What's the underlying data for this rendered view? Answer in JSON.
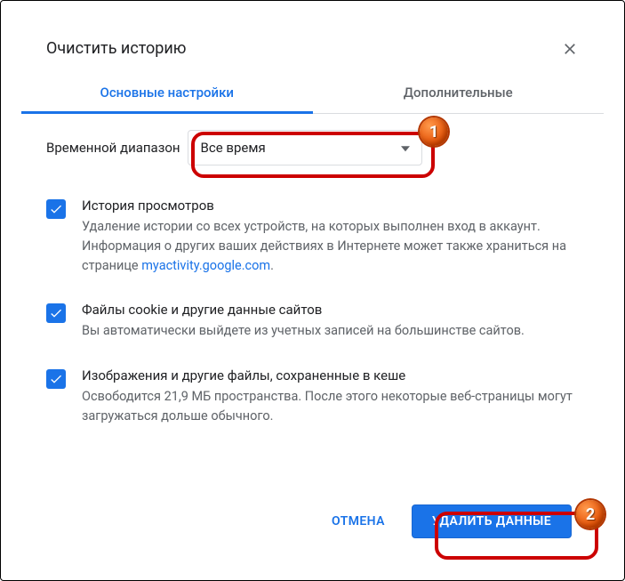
{
  "header": {
    "title": "Очистить историю"
  },
  "tabs": {
    "basic": "Основные настройки",
    "advanced": "Дополнительные"
  },
  "range": {
    "label": "Временной диапазон",
    "value": "Все время"
  },
  "options": [
    {
      "title": "История просмотров",
      "desc_prefix": "Удаление истории со всех устройств, на которых выполнен вход в аккаунт. Информация о других ваших действиях в Интернете может также храниться на странице ",
      "desc_link": "myactivity.google.com",
      "desc_suffix": "."
    },
    {
      "title": "Файлы cookie и другие данные сайтов",
      "desc": "Вы автоматически выйдете из учетных записей на большинстве сайтов."
    },
    {
      "title": "Изображения и другие файлы, сохраненные в кеше",
      "desc": "Освободится 21,9 МБ пространства. После этого некоторые веб-страницы могут загружаться дольше обычного."
    }
  ],
  "footer": {
    "cancel": "Отмена",
    "confirm": "Удалить данные"
  },
  "annotations": {
    "step1": "1",
    "step2": "2"
  }
}
